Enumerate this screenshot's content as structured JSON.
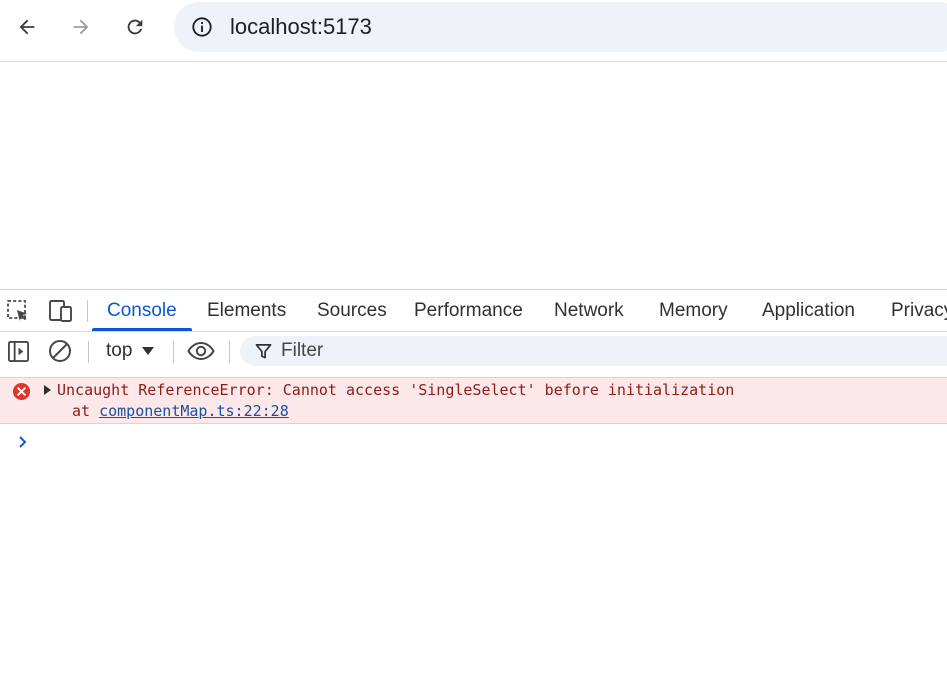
{
  "browser": {
    "url": "localhost:5173",
    "icons": [
      "back-arrow-icon",
      "forward-arrow-icon",
      "reload-icon",
      "site-info-icon"
    ]
  },
  "devtools": {
    "tabs": [
      {
        "label": "Console",
        "active": true
      },
      {
        "label": "Elements",
        "active": false
      },
      {
        "label": "Sources",
        "active": false
      },
      {
        "label": "Performance",
        "active": false
      },
      {
        "label": "Network",
        "active": false
      },
      {
        "label": "Memory",
        "active": false
      },
      {
        "label": "Application",
        "active": false
      },
      {
        "label": "Privacy",
        "active": false
      }
    ],
    "toolbar_icons": [
      "inspect-element-icon",
      "device-toolbar-icon"
    ],
    "console_toolbar": {
      "context": "top",
      "filter_placeholder": "Filter",
      "icons": [
        "sidebar-toggle-icon",
        "clear-console-icon",
        "dropdown-caret-icon",
        "live-expression-eye-icon",
        "filter-funnel-icon"
      ]
    },
    "messages": [
      {
        "level": "error",
        "text": "Uncaught ReferenceError: Cannot access 'SingleSelect' before initialization",
        "at_prefix": "at ",
        "link": "componentMap.ts:22:28"
      }
    ]
  },
  "colors": {
    "accent": "#0b57d0",
    "error_bg": "#fce8e8",
    "error_text": "#8e1a1a",
    "error_icon": "#dc362e",
    "omnibox_bg": "#eef2f9"
  }
}
